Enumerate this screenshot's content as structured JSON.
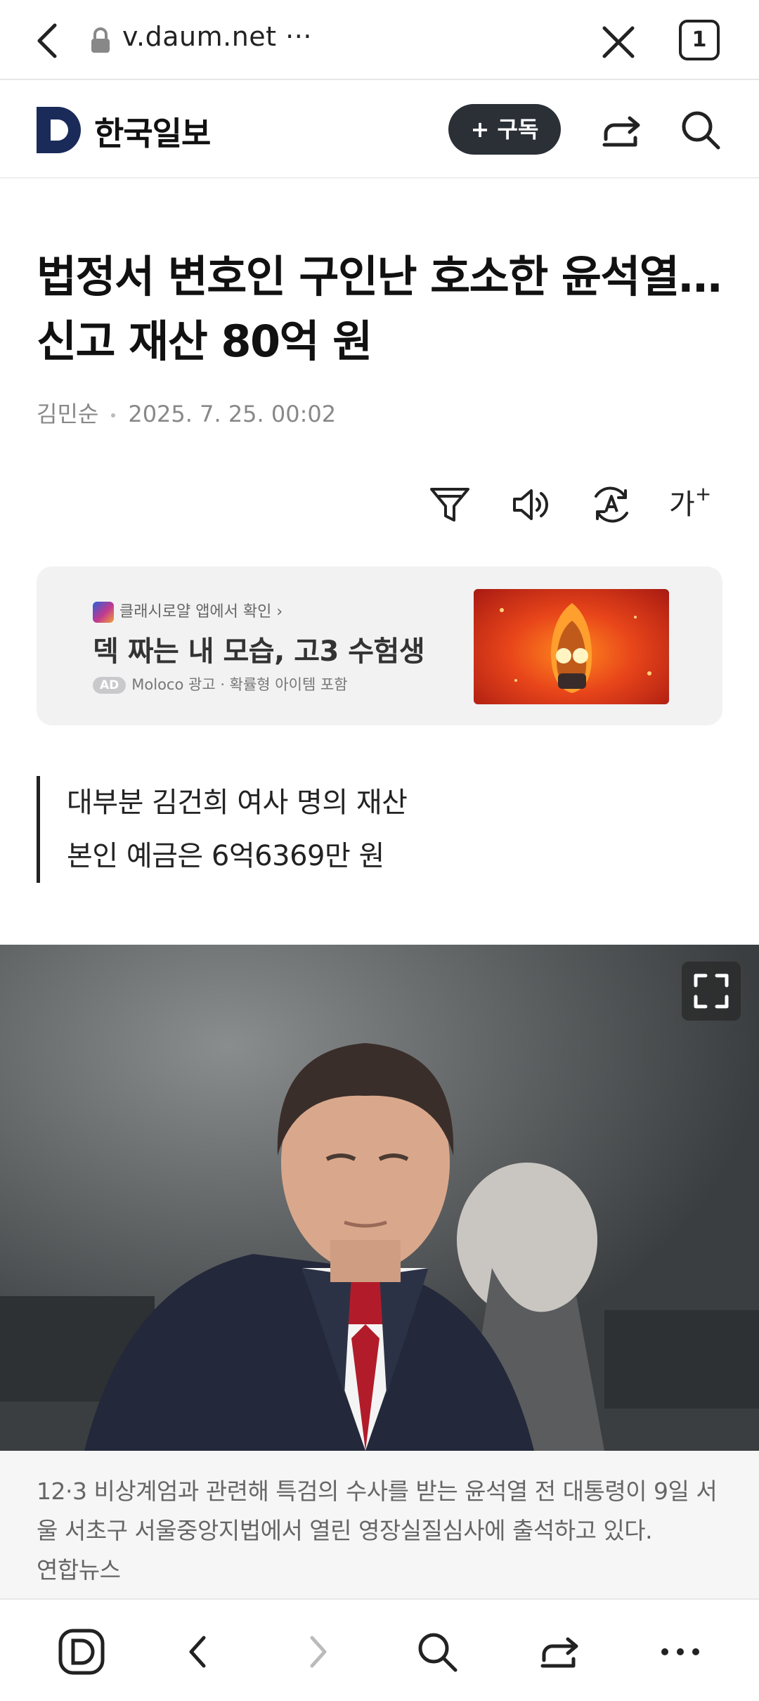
{
  "browser": {
    "url": "v.daum.net",
    "url_more": "···",
    "tab_count": "1"
  },
  "publication": {
    "name": "한국일보",
    "subscribe_label": "+ 구독"
  },
  "article": {
    "headline": "법정서 변호인 구인난 호소한 윤석열…신고 재산 80억 원",
    "author": "김민순",
    "datetime": "2025. 7. 25. 00:02",
    "subheads": [
      "대부분 김건희 여사 명의 재산",
      "본인 예금은 6억6369만 원"
    ],
    "font_size_label": "가"
  },
  "ad": {
    "source": "클래시로얄 앱에서 확인 ›",
    "title": "덱 짜는 내 모습, 고3 수험생",
    "badge": "AD",
    "meta": "Moloco 광고 · 확률형 아이템 포함"
  },
  "photo": {
    "caption": "12·3 비상계엄과 관련해 특검의 수사를 받는 윤석열 전 대통령이 9일 서울 서초구 서울중앙지법에서 열린 영장실질심사에 출석하고 있다.",
    "credit": "연합뉴스"
  },
  "icons": {
    "back": "chevron-left-icon",
    "lock": "lock-icon",
    "close": "close-icon",
    "share": "share-icon",
    "search": "search-icon",
    "filter": "filter-icon",
    "speaker": "speaker-icon",
    "translate": "translate-icon",
    "expand": "fullscreen-icon"
  },
  "colors": {
    "subscribe_bg": "#2b2f36",
    "logo": "#1a2b5a"
  }
}
